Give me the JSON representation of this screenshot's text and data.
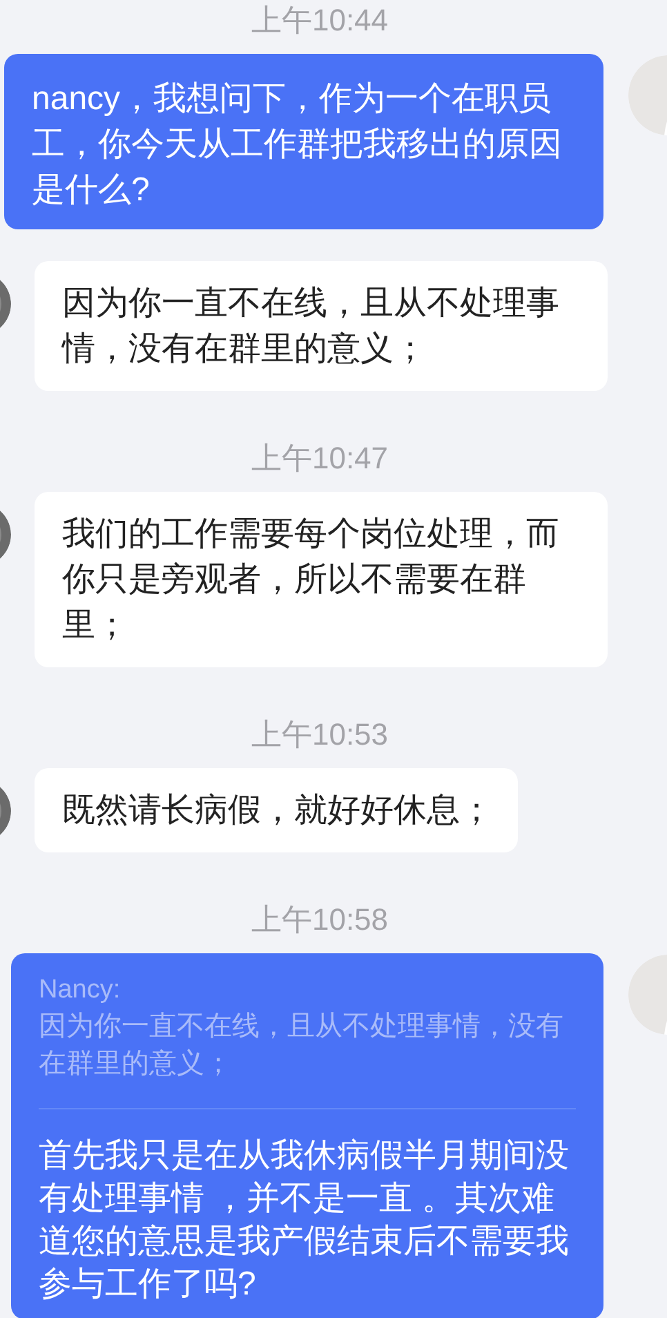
{
  "messages": [
    {
      "kind": "time",
      "text": "上午10:44"
    },
    {
      "kind": "outgoing",
      "text": "nancy，我想问下，作为一个在职员工，你今天从工作群把我移出的原因是什么?"
    },
    {
      "kind": "incoming",
      "text": "因为你一直不在线，且从不处理事情，没有在群里的意义；"
    },
    {
      "kind": "time",
      "text": "上午10:47"
    },
    {
      "kind": "incoming",
      "text": "我们的工作需要每个岗位处理，而你只是旁观者，所以不需要在群里；"
    },
    {
      "kind": "time",
      "text": "上午10:53"
    },
    {
      "kind": "incoming",
      "text": "既然请长病假，就好好休息；"
    },
    {
      "kind": "time",
      "text": "上午10:58"
    },
    {
      "kind": "outgoing",
      "quote": {
        "author": "Nancy:",
        "text": "因为你一直不在线，且从不处理事情，没有在群里的意义；"
      },
      "text": "首先我只是在从我休病假半月期间没有处理事情 ，并不是一直 。其次难道您的意思是我产假结束后不需要我参与工作了吗?"
    }
  ]
}
